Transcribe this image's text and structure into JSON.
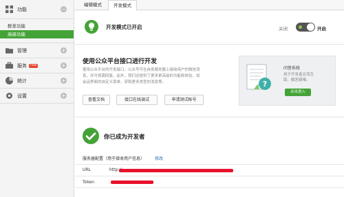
{
  "sidebar": {
    "sections": [
      {
        "label": "功能",
        "icon": "grid-icon",
        "subitems": [
          "群发功能",
          "高级功能"
        ],
        "active": "高级功能"
      },
      {
        "label": "管理",
        "icon": "folder-icon"
      },
      {
        "label": "服务",
        "icon": "briefcase-icon",
        "badge": "new"
      },
      {
        "label": "统计",
        "icon": "chart-icon"
      },
      {
        "label": "设置",
        "icon": "gear-icon"
      }
    ]
  },
  "tabs": [
    "编辑模式",
    "开发模式"
  ],
  "status": {
    "text": "开发模式已开启",
    "switch_off_label": "关闭",
    "switch_on_label": "开启"
  },
  "api": {
    "title": "使用公众平台接口进行开发",
    "desc_lines": [
      "使用公众平台的开发接口，公众号可在自身服务器上接收用户的微信消",
      "息，并可按需回复。此外，我们还提供了更多更高级的功能和体验，如",
      "会话界面的自定义菜单，获取更多类型的消息等。"
    ],
    "buttons": [
      "查看文档",
      "接口在线调试",
      "申请测试帐号"
    ]
  },
  "qa": {
    "title": "问答系统",
    "desc_lines": [
      "用于开发者交流互",
      "助、解答疑难。"
    ],
    "button": "点击进入"
  },
  "developer": {
    "title": "你已成为开发者",
    "config_label": "服务器配置（用于接收用户信息）",
    "edit_link": "修改",
    "rows": [
      {
        "key": "URL",
        "value": "http://"
      },
      {
        "key": "Token",
        "value": ""
      }
    ]
  },
  "colors": {
    "brand_green": "#44a336",
    "link_blue": "#2e6bb8",
    "redact_red": "#e8112d"
  }
}
